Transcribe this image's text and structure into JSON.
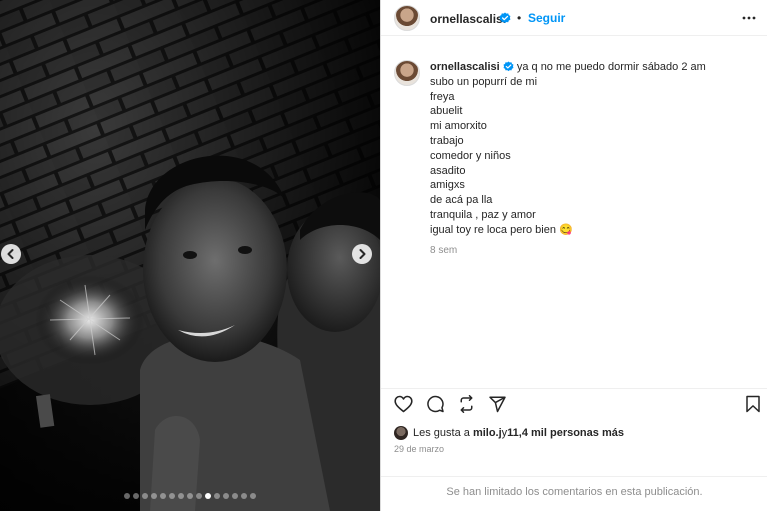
{
  "post": {
    "carousel": {
      "dot_count": 15,
      "active_dot": 9
    },
    "header": {
      "username": "ornellascalisi",
      "separator": "•",
      "follow_label": "Seguir"
    },
    "caption": {
      "username": "ornellascalisi",
      "first_line": "ya q no me puedo dormir sábado 2 am",
      "lines": [
        "subo un popurrí de mi",
        "freya",
        "abuelit",
        "mi amorxito",
        "trabajo",
        "comedor y niños",
        "asadito",
        "amigxs",
        "de acá pa lla",
        "tranquila , paz y amor",
        "igual toy re loca pero bien 😋"
      ],
      "time_ago": "8 sem"
    },
    "likes": {
      "prefix": "Les gusta a ",
      "user": "milo.j",
      "middle": " y ",
      "count": "11,4 mil personas más"
    },
    "date": "29 de marzo",
    "comments_notice": "Se han limitado los comentarios en esta publicación."
  },
  "colors": {
    "accent": "#0095f6",
    "text": "#262626",
    "secondary": "#8e8e8e"
  },
  "icons": {
    "verified": "verified-badge-icon",
    "more": "more-options-icon",
    "like": "heart-icon",
    "comment": "comment-icon",
    "share": "share-icon",
    "send": "send-icon",
    "save": "bookmark-icon",
    "prev": "chevron-left-icon",
    "next": "chevron-right-icon"
  }
}
